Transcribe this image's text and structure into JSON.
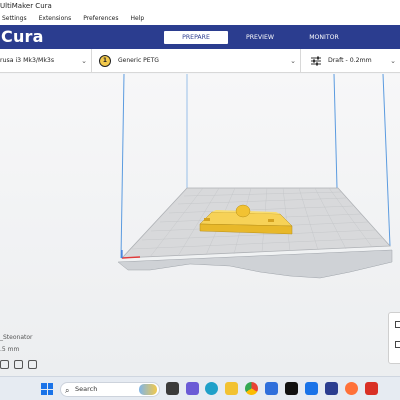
{
  "window": {
    "title": "UltiMaker Cura"
  },
  "menu": {
    "items": [
      "Settings",
      "Extensions",
      "Preferences",
      "Help"
    ]
  },
  "header": {
    "brand": "Cura",
    "tabs": [
      {
        "label": "PREPARE",
        "active": true
      },
      {
        "label": "PREVIEW",
        "active": false
      },
      {
        "label": "MONITOR",
        "active": false
      }
    ]
  },
  "toolbar": {
    "printer": "rusa i3 Mk3/Mk3s",
    "material_badge": "1",
    "material": "Generic PETG",
    "profile": "Draft - 0.2mm"
  },
  "object": {
    "name": "_Steonator",
    "dims": ".5 mm"
  },
  "taskbar": {
    "search_placeholder": "Search",
    "icons": [
      "windows-start",
      "search",
      "task-view",
      "chat",
      "edge",
      "file-explorer",
      "chrome",
      "store",
      "netflix",
      "mail",
      "cura",
      "firefox",
      "acrobat"
    ]
  },
  "colors": {
    "header_bg": "#2b3d8f",
    "model_yellow": "#f2c232",
    "build_volume_line": "#4a90e2"
  }
}
